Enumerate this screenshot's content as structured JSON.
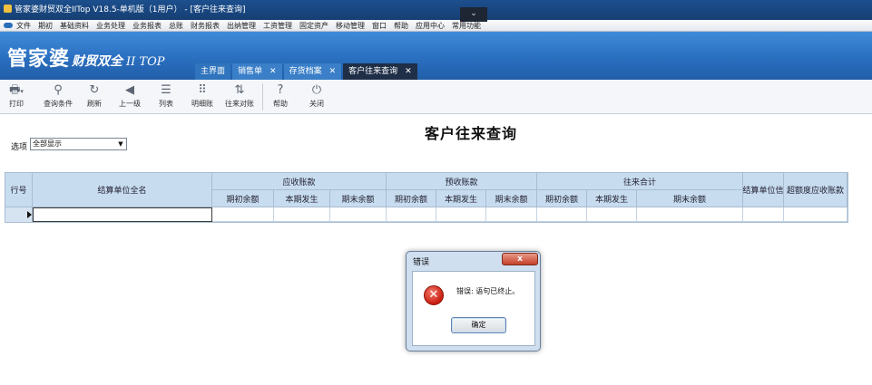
{
  "window": {
    "title": "管家婆财贸双全IITop V18.5-单机版（1用户） - [客户往来查询]",
    "collapse_glyph": "⌄"
  },
  "menubar": {
    "items": [
      "文件",
      "期初",
      "基础资料",
      "业务处理",
      "业务报表",
      "总账",
      "财务报表",
      "出纳管理",
      "工资管理",
      "固定资产",
      "移动管理",
      "窗口",
      "帮助",
      "应用中心",
      "常用功能"
    ]
  },
  "banner": {
    "logo_main": "管家婆",
    "logo_mid": "财贸双全",
    "logo_sub": "II TOP"
  },
  "tabs": [
    {
      "label": "主界面",
      "closable": false
    },
    {
      "label": "销售单",
      "closable": true
    },
    {
      "label": "存货档案",
      "closable": true
    },
    {
      "label": "客户往来查询",
      "closable": true,
      "active": true
    }
  ],
  "toolbar": {
    "buttons": [
      {
        "label": "打印",
        "icon": "printer-icon"
      },
      {
        "label": "查询条件",
        "icon": "search-icon"
      },
      {
        "label": "刷新",
        "icon": "refresh-icon"
      },
      {
        "label": "上一级",
        "icon": "arrow-left-icon"
      },
      {
        "label": "列表",
        "icon": "list-icon"
      },
      {
        "label": "明细账",
        "icon": "grid-icon"
      },
      {
        "label": "往来对账",
        "icon": "swap-icon"
      },
      {
        "label": "帮助",
        "icon": "help-icon"
      },
      {
        "label": "关闭",
        "icon": "power-icon"
      }
    ]
  },
  "filter": {
    "label": "选项",
    "value": "全部显示"
  },
  "page_title": "客户往来查询",
  "grid": {
    "col_row": "行号",
    "col_name": "结算单位全名",
    "group_receivable": "应收账款",
    "group_prereceived": "预收账款",
    "group_total": "往来合计",
    "sub_opening": "期初余额",
    "sub_current": "本期发生",
    "sub_closing": "期末余额",
    "col_unit_info": "结算单位信",
    "col_over_limit": "超额度应收账款"
  },
  "dialog": {
    "title": "错误",
    "close_label": "x",
    "message": "错误: 语句已终止。",
    "ok_label": "确定"
  }
}
